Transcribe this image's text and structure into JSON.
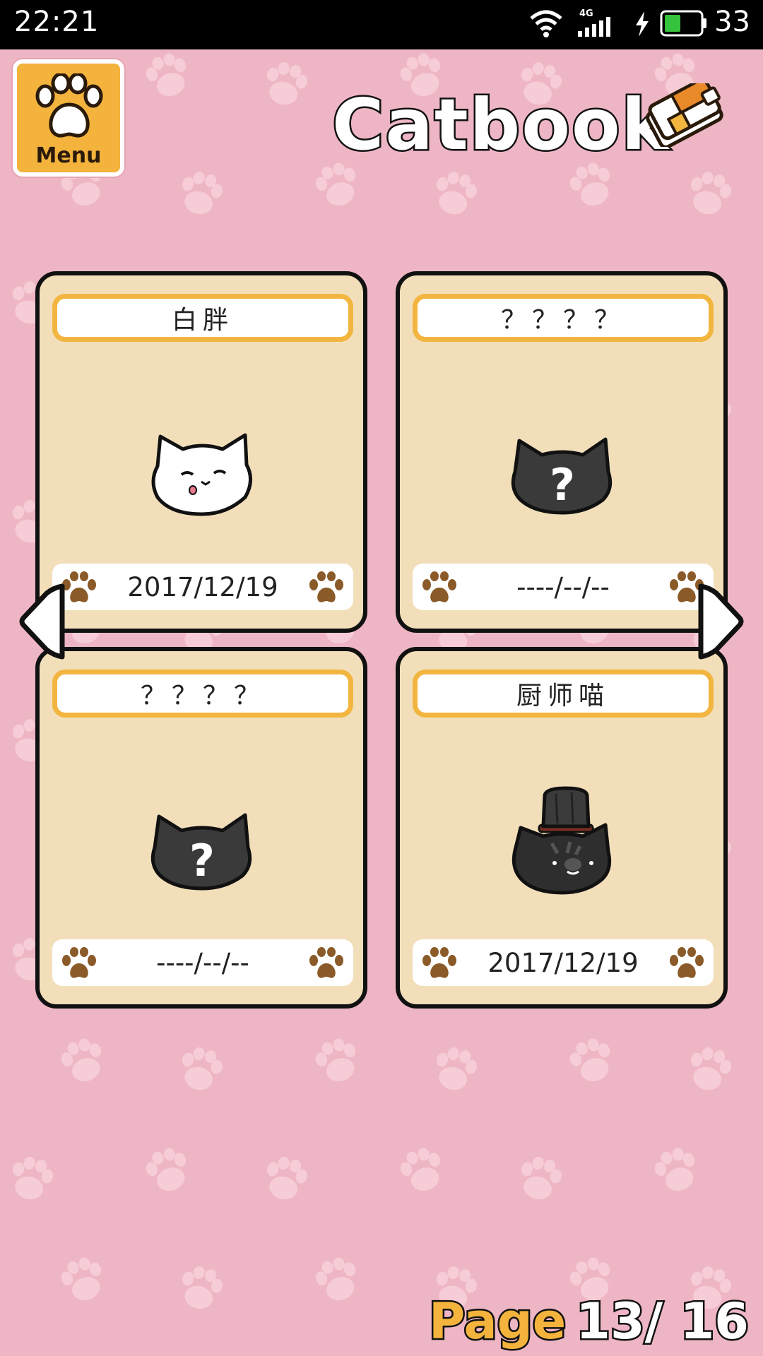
{
  "status_bar": {
    "time": "22:21",
    "battery_level": "33",
    "network": "4G",
    "icons": [
      "wifi-icon",
      "cellular-signal-icon",
      "charging-icon",
      "battery-icon"
    ]
  },
  "header": {
    "menu_label": "Menu",
    "title": "Catbook",
    "icons": [
      "paw-icon",
      "catbook-icon"
    ]
  },
  "cards": [
    {
      "name": "白胖",
      "date": "2017/12/19",
      "cat": "white-cat"
    },
    {
      "name": "？？？？",
      "date": "----/--/--",
      "cat": "unknown-cat"
    },
    {
      "name": "？？？？",
      "date": "----/--/--",
      "cat": "unknown-cat"
    },
    {
      "name": "厨师喵",
      "date": "2017/12/19",
      "cat": "chef-cat"
    }
  ],
  "navigation": {
    "prev_icon": "left-arrow-icon",
    "next_icon": "right-arrow-icon"
  },
  "pagination": {
    "label": "Page",
    "current": "13/ 16"
  },
  "colors": {
    "background": "#eeb6c4",
    "card": "#f2dfba",
    "name_border": "#f2b640",
    "menu": "#f3b33d",
    "paw": "#8a5a28"
  }
}
